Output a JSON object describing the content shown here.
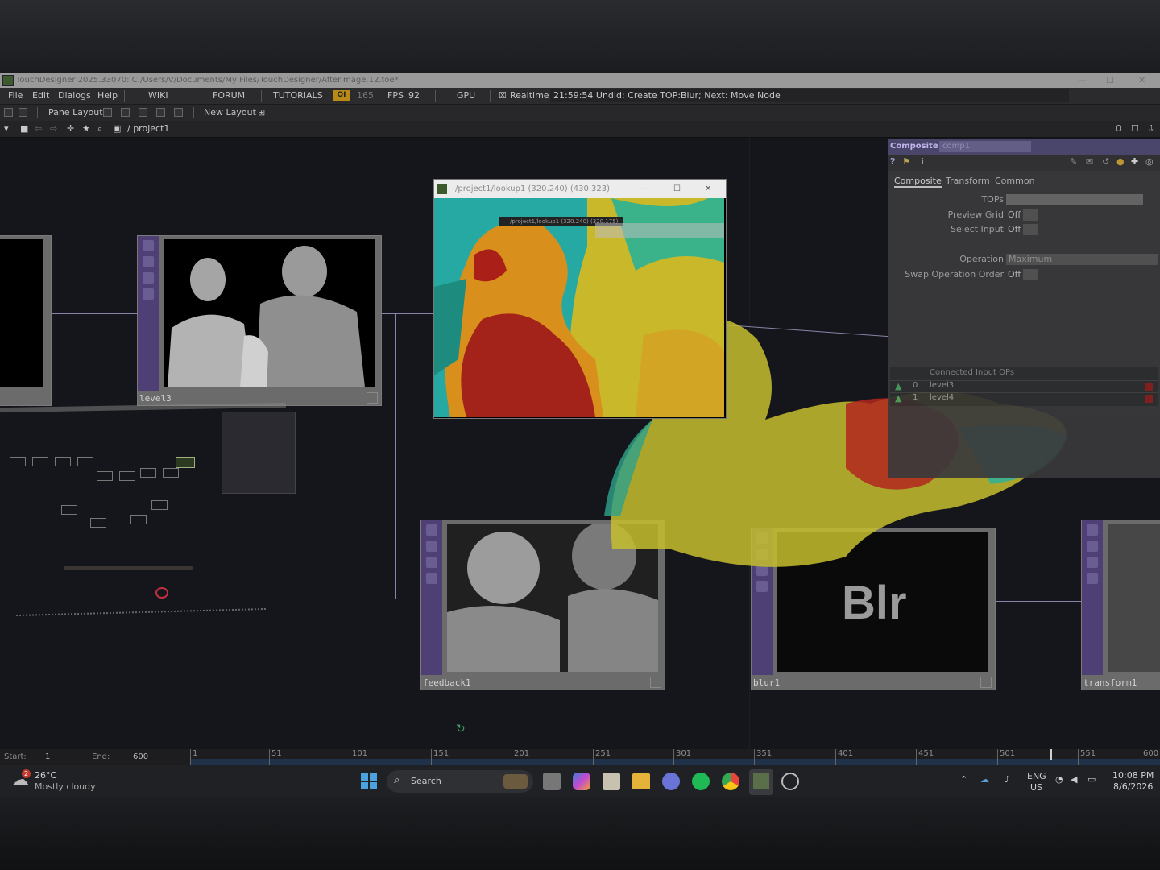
{
  "window": {
    "title": "TouchDesigner 2025.33070: C:/Users/V/Documents/My Files/TouchDesigner/Afterimage.12.toe*",
    "controls": {
      "minimize": "—",
      "maximize": "☐",
      "close": "✕"
    }
  },
  "menu": {
    "items": [
      "File",
      "Edit",
      "Dialogs",
      "Help"
    ],
    "links": [
      "WIKI",
      "FORUM",
      "TUTORIALS"
    ],
    "oi": "OI",
    "frame": "165",
    "fps_label": "FPS",
    "fps_value": "92",
    "gpu": "GPU",
    "realtime_label": "Realtime",
    "status_message": "21:59:54 Undid: Create TOP:Blur; Next: Move Node"
  },
  "layout": {
    "pane_layout": "Pane Layout",
    "new_layout": "New Layout"
  },
  "path": {
    "current": "/ project1",
    "page_num": "0"
  },
  "nodes": {
    "level3": "level3",
    "feedback1": "feedback1",
    "blur1": "blur1",
    "blur_preview_text": "Blr",
    "transform1": "transform1"
  },
  "viewer": {
    "title": "/project1/lookup1 (320.240) (430.323)",
    "inner_title": "/project1/lookup1 (320.240) (320.175)"
  },
  "params": {
    "op_type": "Composite",
    "op_name": "comp1",
    "tabs": [
      "Composite",
      "Transform",
      "Common"
    ],
    "rows": [
      {
        "label": "TOPs",
        "value": ""
      },
      {
        "label": "Preview Grid",
        "value": "Off"
      },
      {
        "label": "Select Input",
        "value": "Off"
      },
      {
        "label": "Operation",
        "value": "Maximum"
      },
      {
        "label": "Swap Operation Order",
        "value": "Off"
      }
    ],
    "connected_header": "Connected Input OPs",
    "connected": [
      {
        "index": "0",
        "name": "level3"
      },
      {
        "index": "1",
        "name": "level4"
      }
    ]
  },
  "timeline": {
    "start_label": "Start:",
    "start_value": "1",
    "end_label": "End:",
    "end_value": "600",
    "ticks": [
      "1",
      "51",
      "101",
      "151",
      "201",
      "251",
      "301",
      "351",
      "401",
      "451",
      "501",
      "551",
      "600"
    ]
  },
  "taskbar": {
    "weather_temp": "26°C",
    "weather_desc": "Mostly cloudy",
    "weather_badge": "2",
    "search": "Search",
    "lang": "ENG",
    "region": "US",
    "time": "10:08 PM",
    "date": "8/6/2026"
  },
  "colors": {
    "accent_purple": "#4e3f74",
    "fps_badge": "#b98a16",
    "taskbar_bg": "#202124"
  }
}
